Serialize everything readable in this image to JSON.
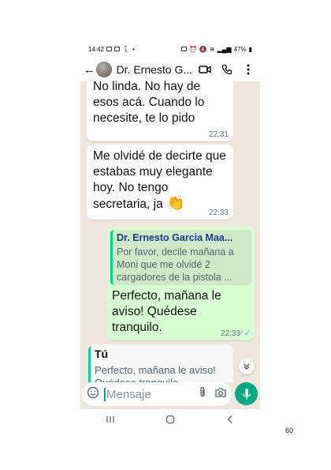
{
  "status": {
    "time": "14:42",
    "battery": "47%"
  },
  "header": {
    "contact_name": "Dr. Ernesto G..."
  },
  "messages": [
    {
      "text": "No linda. No hay de esos acá. Cuando lo necesite, te lo pido",
      "time": "22:31"
    },
    {
      "text": "Me olvidé de decirte que estabas muy elegante hoy. No tengo secretaria, ja",
      "emoji": "👏",
      "time": "22:33"
    },
    {
      "quote_name": "Dr. Ernesto Garcia Maa...",
      "quote_text": "Por favor,  decile mañana a Moni que me olvidé 2 cargadores de la pistola ...",
      "text": "Perfecto, mañana le aviso! Quédese tranquilo.",
      "time": "22:33"
    }
  ],
  "reply": {
    "name": "Tú",
    "text": "Perfecto, mañana le aviso! Quédese tranquilo."
  },
  "input": {
    "placeholder": "Mensaje"
  },
  "page_number": "60",
  "colors": {
    "outgoing": "#d9fdd3",
    "accent": "#00a884",
    "chat_bg": "#efe7de"
  }
}
